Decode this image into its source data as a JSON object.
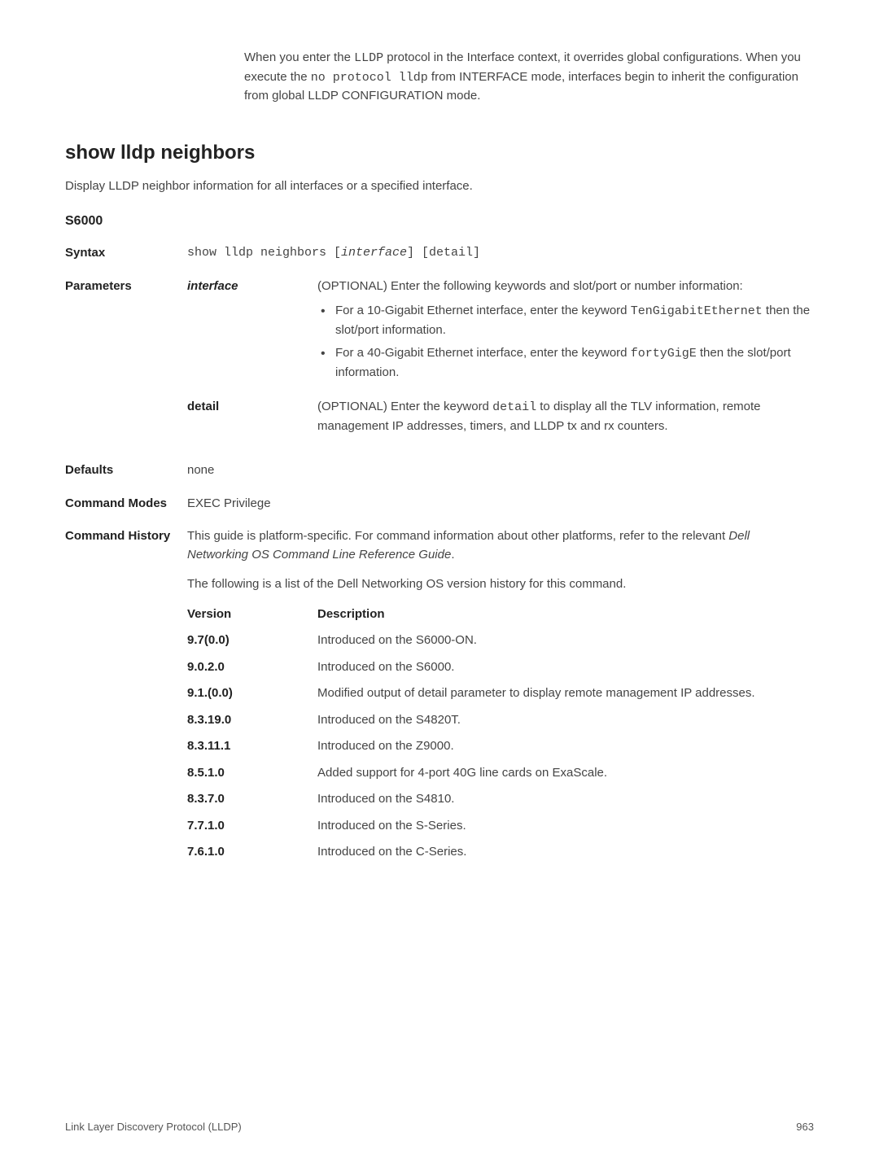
{
  "intro": {
    "text_before_lldp": "When you enter the ",
    "lldp_code": "LLDP",
    "text_mid1": " protocol in the Interface context, it overrides global configurations. When you execute the ",
    "no_protocol_code": "no protocol lldp",
    "text_after": " from INTERFACE mode, interfaces begin to inherit the configuration from global LLDP CONFIGURATION mode."
  },
  "heading": "show lldp neighbors",
  "section_desc": "Display LLDP neighbor information for all interfaces or a specified interface.",
  "platform": "S6000",
  "syntax": {
    "label": "Syntax",
    "value": "show lldp neighbors [interface] [detail]",
    "interface_part": "interface"
  },
  "parameters": {
    "label": "Parameters",
    "interface": {
      "name": "interface",
      "desc1": "(OPTIONAL) Enter the following keywords and slot/port or number information:",
      "bullet1_before": "For a 10-Gigabit Ethernet interface, enter the keyword ",
      "bullet1_code": "TenGigabitEthernet",
      "bullet1_after": " then the slot/port information.",
      "bullet2_before": "For a 40-Gigabit Ethernet interface, enter the keyword ",
      "bullet2_code": "fortyGigE",
      "bullet2_after": " then the slot/port information."
    },
    "detail": {
      "name": "detail",
      "desc_before": "(OPTIONAL) Enter the keyword ",
      "desc_code": "detail",
      "desc_after": " to display all the TLV information, remote management IP addresses, timers, and LLDP tx and rx counters."
    }
  },
  "defaults": {
    "label": "Defaults",
    "value": "none"
  },
  "command_modes": {
    "label": "Command Modes",
    "value": "EXEC Privilege"
  },
  "command_history": {
    "label": "Command History",
    "para1_before": "This guide is platform-specific. For command information about other platforms, refer to the relevant ",
    "para1_italic": "Dell Networking OS Command Line Reference Guide",
    "para1_after": ".",
    "para2": "The following is a list of the Dell Networking OS version history for this command.",
    "header_version": "Version",
    "header_desc": "Description",
    "rows": [
      {
        "version": "9.7(0.0)",
        "desc": "Introduced on the S6000-ON."
      },
      {
        "version": "9.0.2.0",
        "desc": "Introduced on the S6000."
      },
      {
        "version": "9.1.(0.0)",
        "desc": "Modified output of detail parameter to display remote management IP addresses."
      },
      {
        "version": "8.3.19.0",
        "desc": "Introduced on the S4820T."
      },
      {
        "version": "8.3.11.1",
        "desc": "Introduced on the Z9000."
      },
      {
        "version": "8.5.1.0",
        "desc": "Added support for 4-port 40G line cards on ExaScale."
      },
      {
        "version": "8.3.7.0",
        "desc": "Introduced on the S4810."
      },
      {
        "version": "7.7.1.0",
        "desc": "Introduced on the S-Series."
      },
      {
        "version": "7.6.1.0",
        "desc": "Introduced on the C-Series."
      }
    ]
  },
  "footer": {
    "left": "Link Layer Discovery Protocol (LLDP)",
    "right": "963"
  }
}
